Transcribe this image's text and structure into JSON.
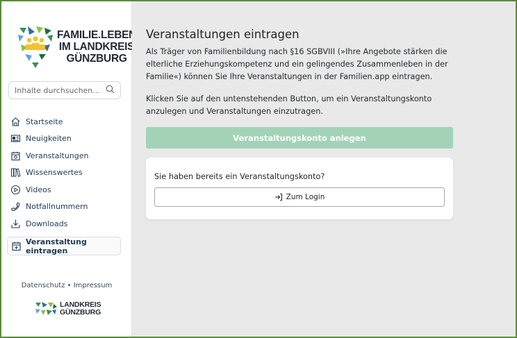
{
  "sidebar": {
    "logo": {
      "line1": "FAMILIE.LEBEN",
      "line2": "IM LANDKREIS",
      "line3": "GÜNZBURG",
      "icon": "family-heart-logo"
    },
    "search": {
      "placeholder": "Inhalte durchsuchen...",
      "icon": "search-icon"
    },
    "nav": [
      {
        "label": "Startseite",
        "icon": "home-icon"
      },
      {
        "label": "Neuigkeiten",
        "icon": "newspaper-icon"
      },
      {
        "label": "Veranstaltungen",
        "icon": "calendar-icon"
      },
      {
        "label": "Wissenswertes",
        "icon": "books-icon"
      },
      {
        "label": "Videos",
        "icon": "play-icon"
      },
      {
        "label": "Notfallnummern",
        "icon": "phone-icon"
      },
      {
        "label": "Downloads",
        "icon": "download-icon"
      }
    ],
    "active_item": {
      "label": "Veranstaltung eintragen",
      "icon": "calendar-plus-icon"
    },
    "footer": {
      "privacy": "Datenschutz",
      "separator": "•",
      "imprint": "Impressum"
    },
    "footer_logo": {
      "line1": "LANDKREIS",
      "line2": "GÜNZBURG"
    }
  },
  "main": {
    "title": "Veranstaltungen eintragen",
    "paragraph1": "Als Träger von Familienbildung nach §16 SGBVIII (»Ihre Angebote stärken die elterliche Erziehungskompetenz und ein gelingendes Zusammenleben in der Familie«) können Sie Ihre Veranstaltungen in der Familien.app eintragen.",
    "paragraph2": "Klicken Sie auf den untenstehenden Button, um ein Veranstaltungskonto anzulegen und Veranstaltungen einzutragen.",
    "cta_label": "Veranstaltungskonto anlegen",
    "card": {
      "question": "Sie haben bereits ein Veranstaltungskonto?",
      "login_label": "Zum Login",
      "login_icon": "login-arrow-icon"
    }
  },
  "colors": {
    "frame": "#5b8a3a",
    "cta": "#a3d3b6",
    "main_bg": "#e9e9e9",
    "nav_text": "#1f3b52"
  }
}
